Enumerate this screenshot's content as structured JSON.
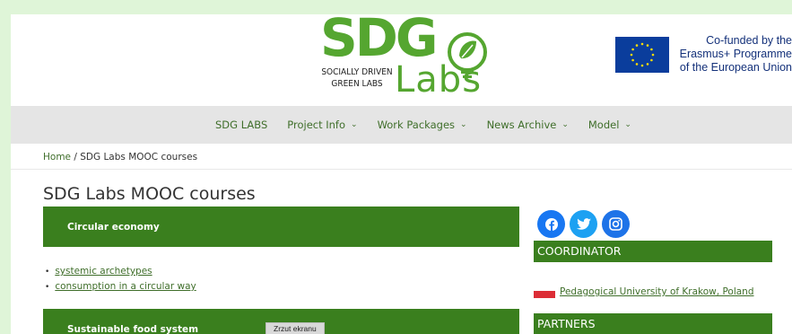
{
  "header": {
    "logo_main": "SDG",
    "logo_sub_line1": "SOCIALLY DRIVEN",
    "logo_sub_line2": "GREEN LABS",
    "logo_labs": "Labs",
    "eu_line1": "Co-funded by the",
    "eu_line2": "Erasmus+ Programme",
    "eu_line3": "of the European Union"
  },
  "nav": {
    "items": [
      {
        "label": "SDG LABS",
        "dropdown": false
      },
      {
        "label": "Project Info",
        "dropdown": true
      },
      {
        "label": "Work Packages",
        "dropdown": true
      },
      {
        "label": "News Archive",
        "dropdown": true
      },
      {
        "label": "Model",
        "dropdown": true
      }
    ],
    "chevron": "⌄"
  },
  "breadcrumb": {
    "home": "Home",
    "separator": " / ",
    "current": "SDG Labs MOOC courses"
  },
  "page_title": "SDG Labs MOOC courses",
  "courses": [
    {
      "title": "Circular economy",
      "links": [
        "systemic archetypes",
        "consumption in a circular way"
      ]
    },
    {
      "title": "Sustainable food system",
      "links": []
    }
  ],
  "tooltip": "Zrzut ekranu",
  "sidebar": {
    "socials": [
      "facebook-icon",
      "twitter-icon",
      "instagram-icon"
    ],
    "coordinator_heading": "COORDINATOR",
    "coordinator_link": "Pedagogical University of Krakow, Poland",
    "partners_heading": "PARTNERS"
  },
  "colors": {
    "brand_green": "#3a7f1e",
    "logo_green": "#55a630",
    "facebook": "#1877f2",
    "twitter": "#1da1f2",
    "instagram": "#1e73e8"
  }
}
